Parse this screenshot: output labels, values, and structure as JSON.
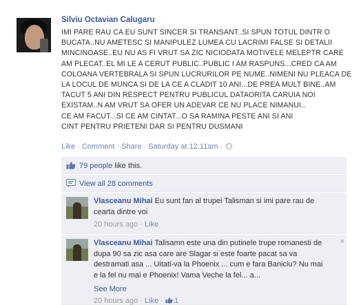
{
  "post": {
    "author": "Silviu Octavian Calugaru",
    "message_lines": [
      "IMI PARE RAU CA EU SUNT SINCER SI TRANSANT..SI SPUN TOTUL DINTR O",
      "BUCATA..NU AMETESC SI MANIPULEZ LUMEA CU LACRIMI FALSE SI DETALII",
      "MINCINOASE..EU NU AS FI VRUT SA ZIC NICIODATA MOTIVELE MELEPTR CARE",
      "AM PLECAT..EL MI LE A CERUT PUBLIC..PUBLIC I AM RASPUNS...CRED CA AM",
      "COLOANA VERTEBRALA SI SPUN LUCRURILOR PE NUME..NIMENI NU PLEACA DE",
      "LA LOCUL DE MUNCA SI DE LA CE A CLADIT 10 ANI...DE PREA MULT BINE..AM",
      "TACUT 5 ANI DIN RESPECT PENTRU PUBLICUL DATAORITA CARUIA NOI",
      "EXISTAM..N AM VRUT SA OFER UN ADEVAR CE NU PLACE NIMANUI..",
      "CE AM FACUT...SI CE AM CINTAT...O SA RAMINA PESTE ANI SI ANI",
      "CINT PENTRU PRIETENI DAR SI PENTRU DUSMANI"
    ],
    "actions": {
      "like": "Like",
      "comment": "Comment",
      "share": "Share",
      "timestamp": "Saturday at 12:11am"
    },
    "likes": {
      "count_text": "79 people",
      "suffix": " like this."
    },
    "view_all": "View all 28 comments"
  },
  "comments": [
    {
      "author": "Vlasceanu Mihai",
      "lines": [
        "Eu sunt fan al trupei Talisman si imi pare rau de",
        "cearta dintre voi"
      ],
      "time": "20 hours ago",
      "like": "Like"
    },
    {
      "author": "Vlasceanu Mihai",
      "lines": [
        "Talisamn este una din putinele trupe romanesti de",
        "dupa 90 sa zic asa care are Slagar si este foarte pacat sa va",
        "destramati asa ... Uitati-va la Phoenix ... cum e fara Baniciu? Nu mai",
        "e la fel nu mai e Phoenix! Vama Veche la fel... a..."
      ],
      "see_more": "See More",
      "time": "20 hours ago",
      "like": "Like",
      "like_count": "1",
      "close": "×"
    }
  ],
  "colors": {
    "link": "#3b5998",
    "muted_link": "#6d84b4",
    "meta": "#999999",
    "comment_bg": "#edeff4"
  },
  "icons": {
    "likes": "thumbs-up-icon",
    "view_all": "comment-bubble-icon",
    "globe": "globe-icon",
    "close": "close-icon"
  }
}
